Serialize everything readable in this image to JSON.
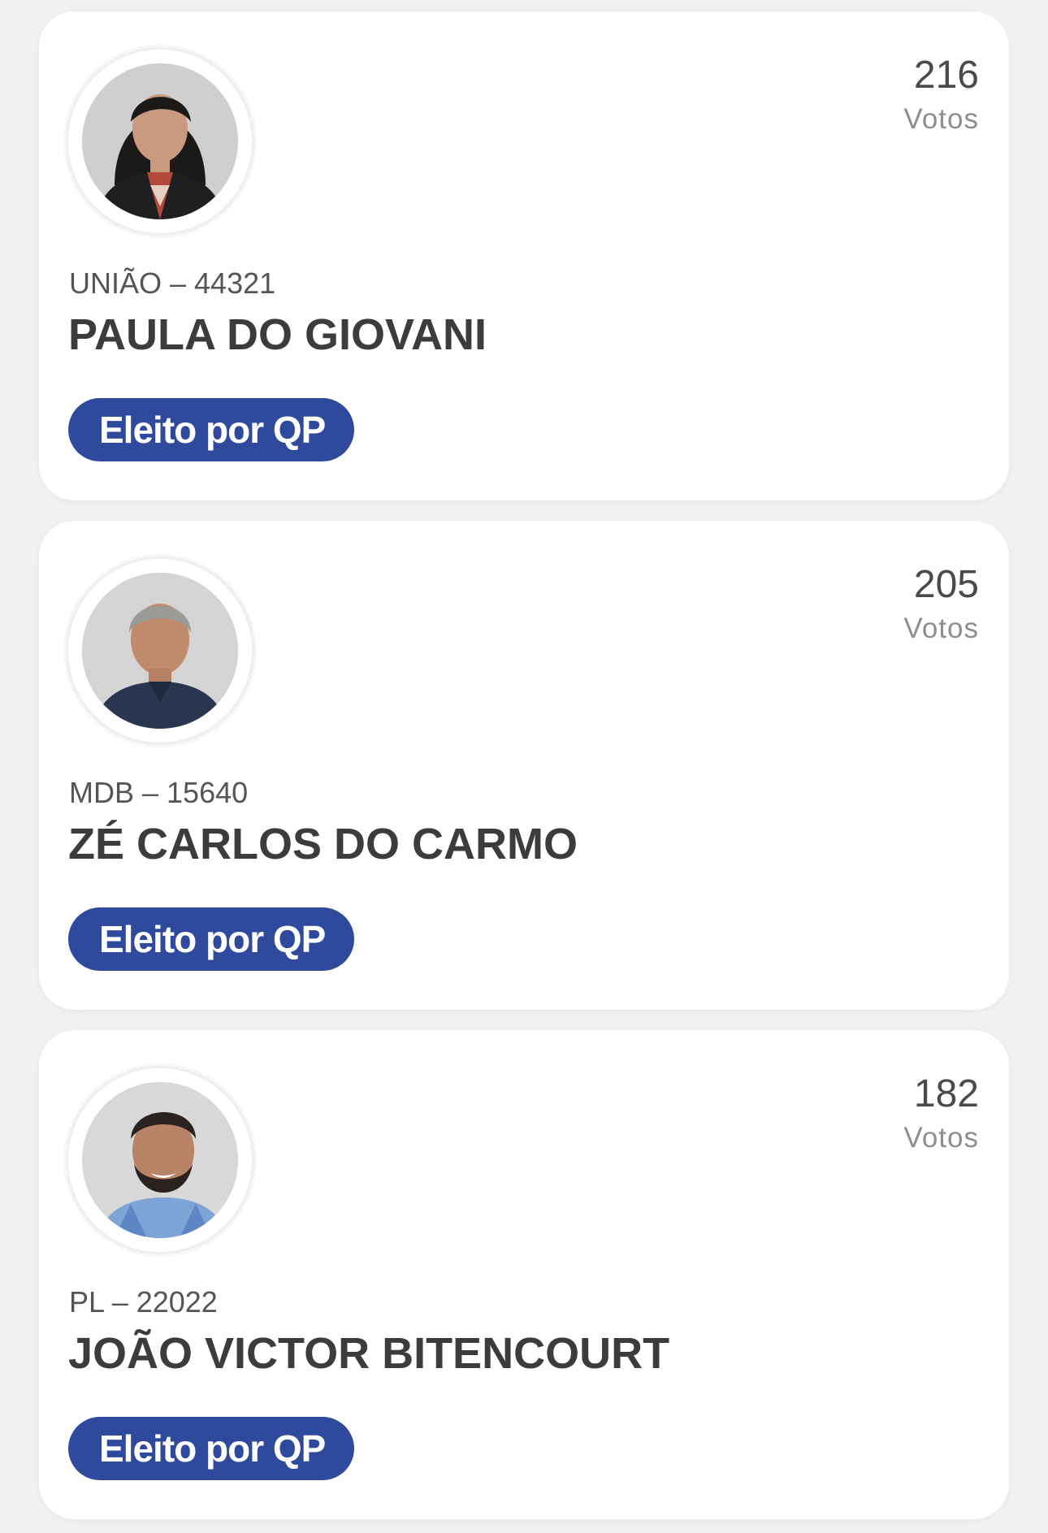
{
  "candidates": [
    {
      "votes": "216",
      "votes_label": "Votos",
      "party_number": "UNIÃO – 44321",
      "name": "PAULA DO GIOVANI",
      "status": "Eleito por QP"
    },
    {
      "votes": "205",
      "votes_label": "Votos",
      "party_number": "MDB – 15640",
      "name": "ZÉ CARLOS DO CARMO",
      "status": "Eleito por QP"
    },
    {
      "votes": "182",
      "votes_label": "Votos",
      "party_number": "PL – 22022",
      "name": "JOÃO VICTOR BITENCOURT",
      "status": "Eleito por QP"
    }
  ],
  "colors": {
    "badge": "#2f4a9c",
    "background": "#f1f1f1",
    "card": "#ffffff"
  }
}
